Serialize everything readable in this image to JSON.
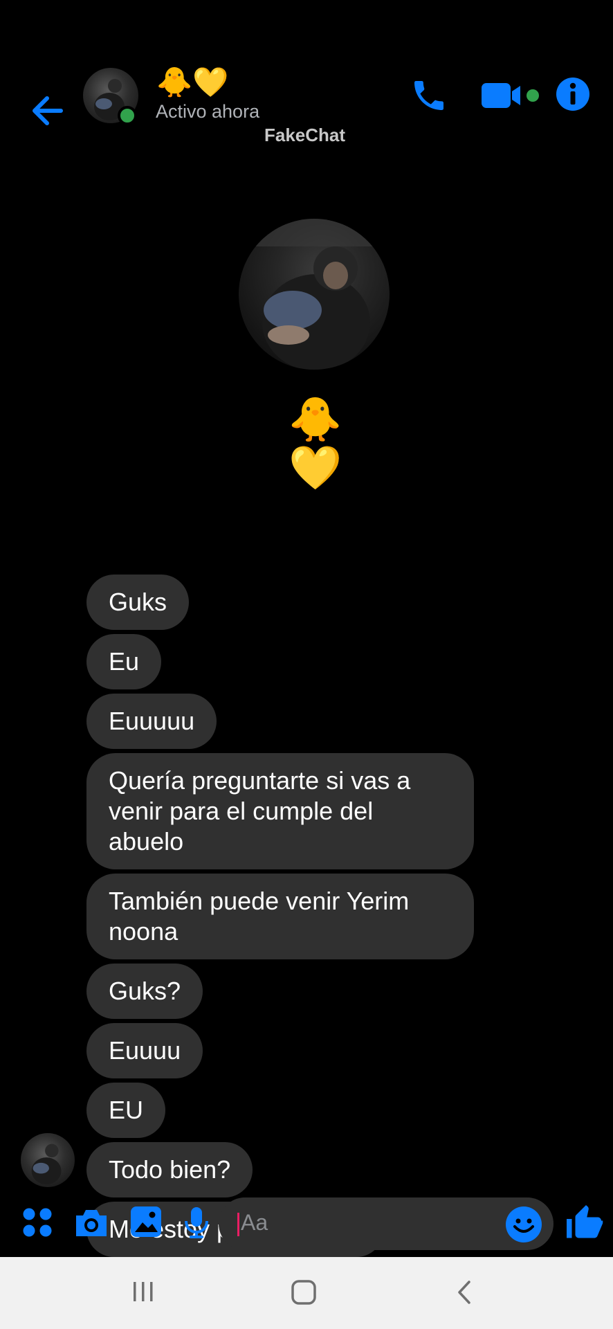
{
  "header": {
    "contact_name": "🐥💛",
    "status": "Activo ahora",
    "watermark": "FakeChat",
    "icons": [
      "back-arrow-icon",
      "phone-icon",
      "video-camera-icon",
      "info-icon"
    ]
  },
  "profile": {
    "name": "🐥💛"
  },
  "messages": [
    {
      "text": "Guks"
    },
    {
      "text": "Eu"
    },
    {
      "text": "Euuuuu"
    },
    {
      "text": "Quería preguntarte si vas a venir para el cumple del abuelo"
    },
    {
      "text": "También puede venir Yerim noona"
    },
    {
      "text": "Guks?"
    },
    {
      "text": "Euuuu"
    },
    {
      "text": "EU"
    },
    {
      "text": "Todo bien?"
    },
    {
      "text": "Me estoy preocupando"
    }
  ],
  "composer": {
    "placeholder": "Aa",
    "icons": [
      "apps-grid-icon",
      "camera-icon",
      "gallery-icon",
      "microphone-icon",
      "emoji-icon",
      "thumbs-up-icon"
    ]
  },
  "colors": {
    "accent": "#0a7cff",
    "online": "#31a24c",
    "bubble": "#303030",
    "background": "#000000"
  }
}
